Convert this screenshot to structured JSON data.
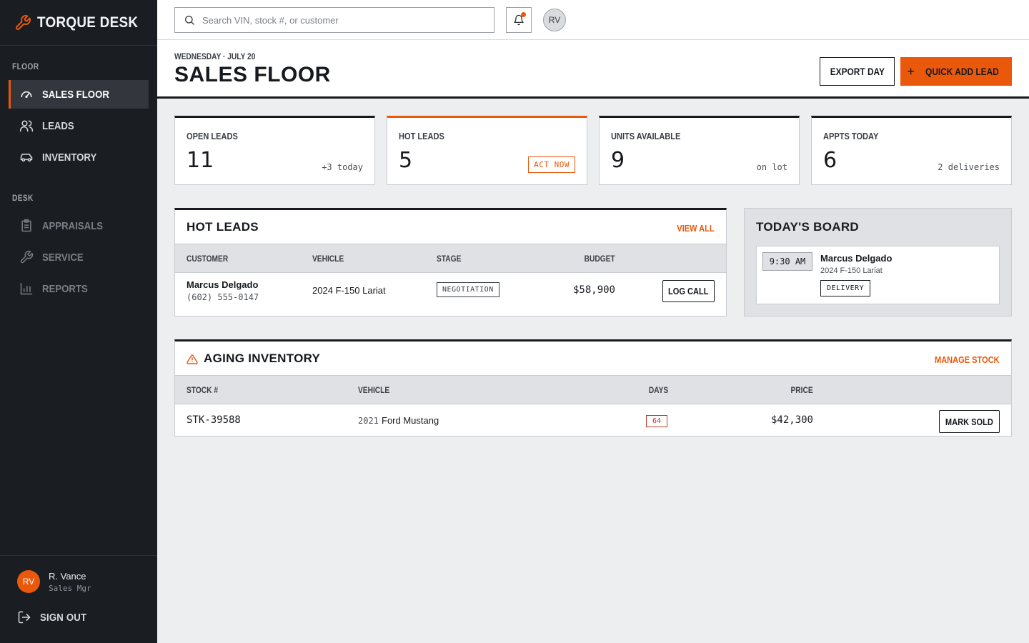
{
  "app": {
    "name": "TORQUE DESK"
  },
  "sidebar": {
    "sections": [
      {
        "label": "FLOOR"
      },
      {
        "label": "DESK"
      }
    ],
    "items": [
      {
        "label": "SALES FLOOR",
        "icon": "gauge-icon",
        "active": true
      },
      {
        "label": "LEADS",
        "icon": "users-icon"
      },
      {
        "label": "INVENTORY",
        "icon": "car-icon"
      },
      {
        "label": "APPRAISALS",
        "icon": "clipboard-icon"
      },
      {
        "label": "SERVICE",
        "icon": "wrench-icon"
      },
      {
        "label": "REPORTS",
        "icon": "bar-chart-icon"
      }
    ],
    "user": {
      "initials": "RV",
      "name": "R. Vance",
      "role": "Sales Mgr"
    },
    "signout_label": "SIGN OUT"
  },
  "topbar": {
    "search_placeholder": "Search VIN, stock #, or customer",
    "avatar_initials": "RV"
  },
  "header": {
    "eyebrow": "WEDNESDAY · JULY 20",
    "title": "SALES FLOOR",
    "export_label": "EXPORT DAY",
    "quick_add_label": "QUICK ADD LEAD"
  },
  "kpis": [
    {
      "label": "OPEN LEADS",
      "value": "11",
      "note": "+3 today"
    },
    {
      "label": "HOT LEADS",
      "value": "5",
      "badge": "ACT NOW"
    },
    {
      "label": "UNITS AVAILABLE",
      "value": "9",
      "note": "on lot"
    },
    {
      "label": "APPTS TODAY",
      "value": "6",
      "note": "2 deliveries"
    }
  ],
  "hot_leads": {
    "title": "HOT LEADS",
    "link": "VIEW ALL",
    "columns": [
      "CUSTOMER",
      "VEHICLE",
      "STAGE",
      "BUDGET"
    ],
    "rows": [
      {
        "customer": "Marcus Delgado",
        "phone": "(602) 555-0147",
        "vehicle": "2024 F-150 Lariat",
        "stage": "NEGOTIATION",
        "budget": "$58,900",
        "action": "LOG CALL"
      }
    ]
  },
  "board": {
    "title": "TODAY'S BOARD",
    "items": [
      {
        "time": "9:30 AM",
        "name": "Marcus Delgado",
        "vehicle": "2024 F-150 Lariat",
        "type": "DELIVERY"
      }
    ]
  },
  "aging": {
    "title": "AGING INVENTORY",
    "link": "MANAGE STOCK",
    "columns": [
      "STOCK #",
      "VEHICLE",
      "DAYS",
      "PRICE"
    ],
    "rows": [
      {
        "stock": "STK-39588",
        "year": "2021",
        "model": "Ford Mustang",
        "days": "64",
        "price": "$42,300",
        "action": "MARK SOLD"
      }
    ]
  },
  "colors": {
    "accent": "#ea580c",
    "sidebar": "#1a1d21",
    "danger": "#c0392b"
  }
}
